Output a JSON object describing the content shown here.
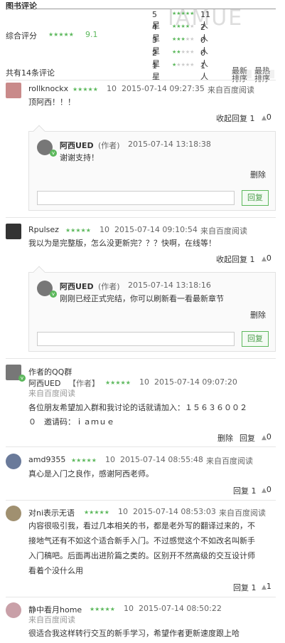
{
  "header": {
    "section_title": "图书评论",
    "watermark": "IAMUE"
  },
  "summary": {
    "overall_label": "综合评分",
    "overall_stars": "★★★★★",
    "overall_score": "9.1",
    "distribution": [
      {
        "label": "5星",
        "stars": 5,
        "count": "11人"
      },
      {
        "label": "4星",
        "stars": 4,
        "count": "2人"
      },
      {
        "label": "3星",
        "stars": 3,
        "count": "0人"
      },
      {
        "label": "2星",
        "stars": 2,
        "count": "0人"
      },
      {
        "label": "1星",
        "stars": 1,
        "count": "1人"
      }
    ],
    "total": "共有14条评论",
    "sort_latest": "最新\n排序",
    "sort_hot": "最热\n排序"
  },
  "colors": {
    "accent_green": "#5cb85c",
    "separator": "#e6e6e6"
  },
  "labels": {
    "collapse_reply": "收起回复",
    "reply": "回复",
    "delete": "删除",
    "reply_button": "回复",
    "author_tag": "(作者)",
    "thumb_icon": "thumbs-up-icon"
  },
  "comments": [
    {
      "user": "rollknockx",
      "stars": "★★★★★",
      "rating": "10",
      "time": "2015-07-14 09:27:35",
      "source": "来自百度阅读",
      "text": "顶阿西！！！",
      "reply_count": "1",
      "likes": "0",
      "reply": {
        "user": "阿西UED",
        "tag": "(作者)",
        "time": "2015-07-14 13:18:38",
        "text": "谢谢支持！"
      }
    },
    {
      "user": "Rpulsez",
      "stars": "★★★★★",
      "rating": "10",
      "time": "2015-07-14 09:10:54",
      "source": "来自百度阅读",
      "text": "我以为是完整版，怎么没更新完？？？快啊，在线等！",
      "reply_count": "1",
      "likes": "0",
      "reply": {
        "user": "阿西UED",
        "tag": "(作者)",
        "time": "2015-07-14 13:18:16",
        "text": "刚刚已经正式完结，你可以刷新看一看最新章节"
      }
    },
    {
      "title": "作者的QQ群",
      "user": "阿西UED",
      "tag": "【作者】",
      "stars": "★★★★★",
      "rating": "10",
      "time": "2015-07-14 09:07:20",
      "source": "来自百度阅读",
      "text_line1": "各位朋友希望加入群和我讨论的话就请加入：１５６３６００２",
      "text_line2": "０　邀请码：ｉａｍｕｅ",
      "delete": "删除",
      "reply_label": "回复",
      "likes": "0"
    },
    {
      "user": "amd9355",
      "stars": "★★★★★",
      "rating": "10",
      "time": "2015-07-14 08:55:48",
      "source": "来自百度阅读",
      "text": "真心是入门之良作，感谢阿西老师。",
      "reply_count": "1",
      "likes": "0"
    },
    {
      "user": "对ni表示无语",
      "stars": "★★★★★",
      "rating": "10",
      "time": "2015-07-14 08:53:03",
      "source": "来自百度阅读",
      "lines": [
        "内容很吸引我，看过几本相关的书，都是老外写的翻译过来的，不",
        "接地气还有不如这个适合新手入门。不过感觉这个不如改名叫新手",
        "入门稿吧。后面再出进阶篇之类的。区别开不然高级的交互设计师",
        "看着个没什么用"
      ],
      "reply_count": "1",
      "likes": "1"
    },
    {
      "user": "静中看月home",
      "stars": "★★★★★",
      "rating": "10",
      "time": "2015-07-14 08:50:22",
      "source": "来自百度阅读",
      "text": "很适合我这样转行交互的新手学习，希望作者更新速度跟上哈"
    }
  ]
}
